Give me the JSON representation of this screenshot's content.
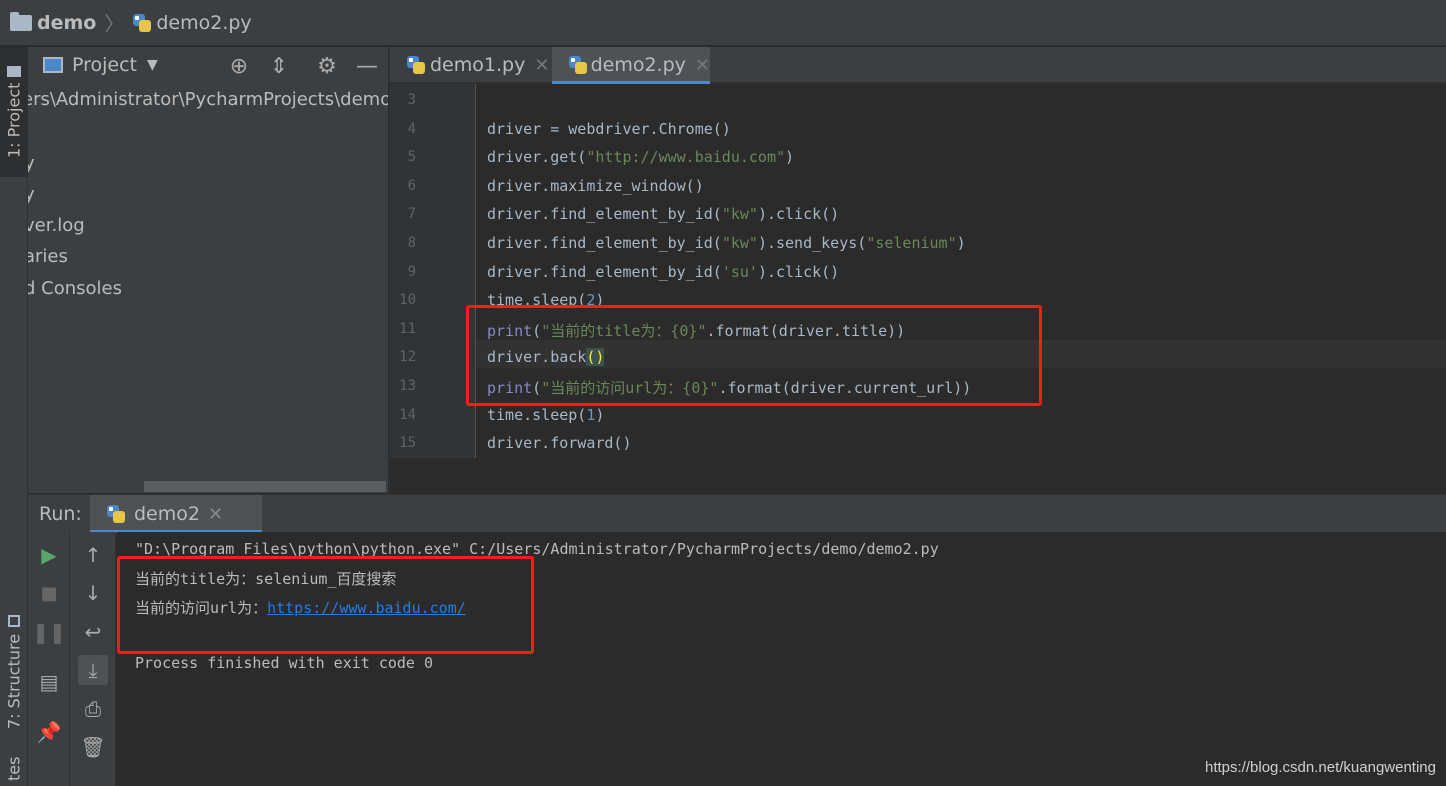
{
  "breadcrumb": {
    "project": "demo",
    "file": "demo2.py"
  },
  "tool_windows": {
    "project": "1: Project",
    "structure": "7: Structure",
    "favorites": "tes"
  },
  "project_panel": {
    "title": "Project",
    "tree": [
      "ers\\Administrator\\PycharmProjects\\demo",
      "y",
      "y",
      "ver.log",
      "aries",
      "d Consoles"
    ]
  },
  "editor_tabs": [
    {
      "label": "demo1.py",
      "active": false
    },
    {
      "label": "demo2.py",
      "active": true
    }
  ],
  "code": {
    "current_line": 12,
    "lines": [
      {
        "n": "3",
        "text": ""
      },
      {
        "n": "4",
        "text": "driver = webdriver.Chrome()"
      },
      {
        "n": "5",
        "text": "driver.get(\"http://www.baidu.com\")"
      },
      {
        "n": "6",
        "text": "driver.maximize_window()"
      },
      {
        "n": "7",
        "text": "driver.find_element_by_id(\"kw\").click()"
      },
      {
        "n": "8",
        "text": "driver.find_element_by_id(\"kw\").send_keys(\"selenium\")"
      },
      {
        "n": "9",
        "text": "driver.find_element_by_id('su').click()"
      },
      {
        "n": "10",
        "text": "time.sleep(2)"
      },
      {
        "n": "11",
        "text": "print(\"当前的title为：{0}\".format(driver.title))"
      },
      {
        "n": "12",
        "text": "driver.back()"
      },
      {
        "n": "13",
        "text": "print(\"当前的访问url为：{0}\".format(driver.current_url))"
      },
      {
        "n": "14",
        "text": "time.sleep(1)"
      },
      {
        "n": "15",
        "text": "driver.forward()"
      }
    ]
  },
  "run_panel": {
    "label": "Run:",
    "tab": "demo2",
    "console": {
      "cmd": "\"D:\\Program Files\\python\\python.exe\" C:/Users/Administrator/PycharmProjects/demo/demo2.py",
      "title_line": "当前的title为：selenium_百度搜索",
      "url_prefix": "当前的访问url为：",
      "url_link": "https://www.baidu.com/",
      "exit_line": "Process finished with exit code 0"
    }
  },
  "watermark": "https://blog.csdn.net/kuangwenting",
  "colors": {
    "annotation_red": "#ff1a1a",
    "accent_blue": "#4a88c7",
    "link_blue": "#287bde"
  }
}
